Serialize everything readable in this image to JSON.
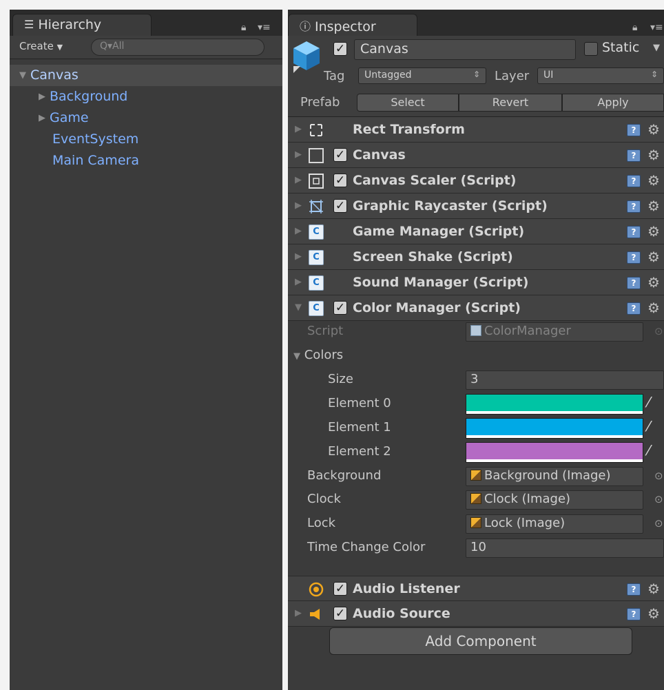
{
  "hierarchy": {
    "title": "Hierarchy",
    "create_label": "Create",
    "search_placeholder": "Q▾All",
    "items": [
      {
        "label": "Canvas",
        "arrow": "▼"
      },
      {
        "label": "Background",
        "arrow": "▶"
      },
      {
        "label": "Game",
        "arrow": "▶"
      },
      {
        "label": "EventSystem",
        "arrow": ""
      },
      {
        "label": "Main Camera",
        "arrow": ""
      }
    ]
  },
  "inspector": {
    "title": "Inspector",
    "object_name": "Canvas",
    "static_label": "Static",
    "tag_label": "Tag",
    "tag_value": "Untagged",
    "layer_label": "Layer",
    "layer_value": "UI",
    "prefab_label": "Prefab",
    "prefab_buttons": [
      "Select",
      "Revert",
      "Apply"
    ],
    "components": [
      {
        "name": "Rect Transform",
        "icon": "rect-transform-icon",
        "checkbox": false
      },
      {
        "name": "Canvas",
        "icon": "canvas-icon",
        "checkbox": true
      },
      {
        "name": "Canvas Scaler (Script)",
        "icon": "canvas-scaler-icon",
        "checkbox": true
      },
      {
        "name": "Graphic Raycaster (Script)",
        "icon": "graphic-raycaster-icon",
        "checkbox": true
      },
      {
        "name": "Game Manager (Script)",
        "icon": "script-icon",
        "checkbox": false
      },
      {
        "name": "Screen Shake (Script)",
        "icon": "script-icon",
        "checkbox": false
      },
      {
        "name": "Sound Manager (Script)",
        "icon": "script-icon",
        "checkbox": false
      },
      {
        "name": "Color Manager (Script)",
        "icon": "script-icon",
        "checkbox": true
      }
    ],
    "color_manager": {
      "script_label": "Script",
      "script_value": "ColorManager",
      "colors_label": "Colors",
      "size_label": "Size",
      "size_value": "3",
      "elements": [
        {
          "label": "Element 0",
          "color": "#00c4a4"
        },
        {
          "label": "Element 1",
          "color": "#00a9e6"
        },
        {
          "label": "Element 2",
          "color": "#b46ac4"
        }
      ],
      "background_label": "Background",
      "background_value": "Background (Image)",
      "clock_label": "Clock",
      "clock_value": "Clock (Image)",
      "lock_label": "Lock",
      "lock_value": "Lock (Image)",
      "time_change_label": "Time Change Color",
      "time_change_value": "10"
    },
    "extra_components": [
      {
        "name": "Audio Listener",
        "icon": "audio-listener-icon"
      },
      {
        "name": "Audio Source",
        "icon": "audio-source-icon"
      }
    ],
    "add_component_label": "Add Component"
  },
  "colors": {
    "panel_bg": "#3b3b3b",
    "link_blue": "#7fb0ff",
    "audio_orange": "#f2a81c"
  }
}
